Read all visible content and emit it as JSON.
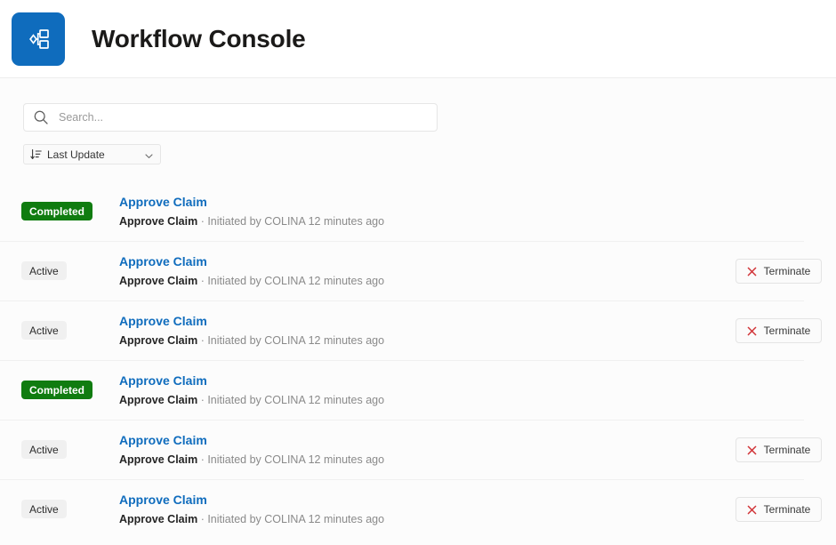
{
  "header": {
    "title": "Workflow Console",
    "logo_icon": "workflow-diagram-icon",
    "logo_color": "#0f6cbd"
  },
  "toolbar": {
    "search": {
      "icon": "search-icon",
      "placeholder": "Search...",
      "value": ""
    },
    "sort": {
      "icon": "sort-descending-icon",
      "label": "Last Update",
      "chevron": "chevron-down-icon"
    }
  },
  "colors": {
    "accent": "#0f6cbd",
    "completed": "#107c10",
    "active_badge_bg": "#f0f0f0",
    "danger": "#d13438",
    "divider": "#f0f0f0",
    "page_bg": "#fcfcfc"
  },
  "action": {
    "terminate_label": "Terminate",
    "terminate_icon": "close-x-icon"
  },
  "rows": [
    {
      "status": "Completed",
      "title": "Approve Claim",
      "subtitle_name": "Approve Claim",
      "subtitle_rest": " · Initiated by COLINA 12 minutes ago",
      "has_terminate": false
    },
    {
      "status": "Active",
      "title": "Approve Claim",
      "subtitle_name": "Approve Claim",
      "subtitle_rest": " · Initiated by COLINA 12 minutes ago",
      "has_terminate": true
    },
    {
      "status": "Active",
      "title": "Approve Claim",
      "subtitle_name": "Approve Claim",
      "subtitle_rest": " · Initiated by COLINA 12 minutes ago",
      "has_terminate": true
    },
    {
      "status": "Completed",
      "title": "Approve Claim",
      "subtitle_name": "Approve Claim",
      "subtitle_rest": " · Initiated by COLINA 12 minutes ago",
      "has_terminate": false
    },
    {
      "status": "Active",
      "title": "Approve Claim",
      "subtitle_name": "Approve Claim",
      "subtitle_rest": " · Initiated by COLINA 12 minutes ago",
      "has_terminate": true
    },
    {
      "status": "Active",
      "title": "Approve Claim",
      "subtitle_name": "Approve Claim",
      "subtitle_rest": " · Initiated by COLINA 12 minutes ago",
      "has_terminate": true
    }
  ]
}
